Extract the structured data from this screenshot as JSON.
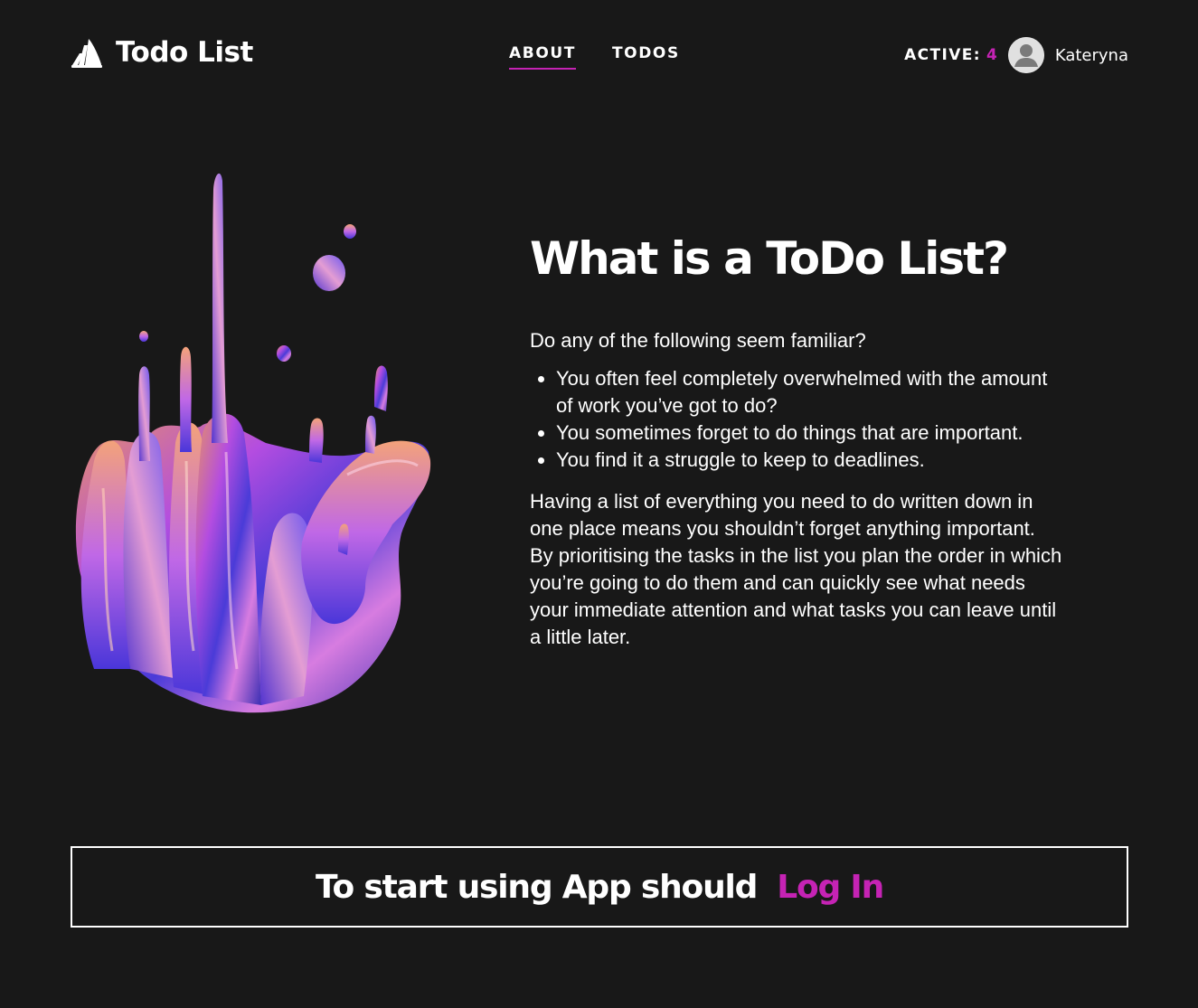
{
  "header": {
    "brand_name": "Todo List",
    "logo_icon": "stacked-books-icon",
    "nav": [
      {
        "label": "ABOUT",
        "active": true
      },
      {
        "label": "TODOS",
        "active": false
      }
    ],
    "active_label": "ACTIVE:",
    "active_count": "4",
    "avatar_icon": "user-avatar-icon",
    "username": "Kateryna"
  },
  "about": {
    "title": "What is a ToDo List?",
    "intro": "Do any of the following seem familiar?",
    "bullets": [
      "You often feel completely overwhelmed with the amount of work you’ve got to do?",
      "You sometimes forget to do things that are important.",
      "You find it a struggle to keep to deadlines."
    ],
    "paragraph": "Having a list of everything you need to do written down in one place means you shouldn’t forget anything important. By prioritising the tasks in the list you plan the order in which you’re going to do them and can quickly see what needs your immediate attention and what tasks you can leave until a little later."
  },
  "cta": {
    "text": "To start using App should",
    "link_label": "Log In"
  },
  "colors": {
    "background": "#181818",
    "accent": "#c523b4",
    "text": "#ffffff"
  }
}
